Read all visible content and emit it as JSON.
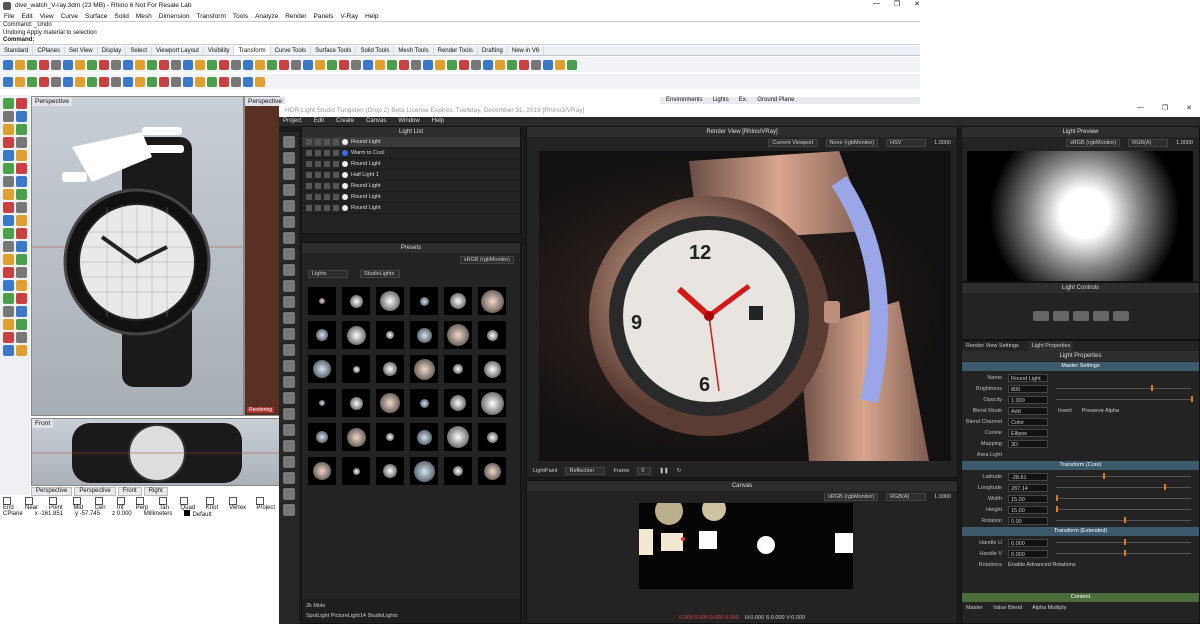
{
  "rhino": {
    "title": "dive_watch_V-ray.3dm (23 MB) - Rhino 6 Not For Resale Lab",
    "window_controls": [
      "—",
      "❐",
      "✕"
    ],
    "menu": [
      "File",
      "Edit",
      "View",
      "Curve",
      "Surface",
      "Solid",
      "Mesh",
      "Dimension",
      "Transform",
      "Tools",
      "Analyze",
      "Render",
      "Panels",
      "V-Ray",
      "Help"
    ],
    "command_lines": [
      "Command: _Undo",
      "Undoing Apply material to selection"
    ],
    "command_prompt": "Command:",
    "toolbar_tabs": [
      "Standard",
      "CPlanes",
      "Set View",
      "Display",
      "Select",
      "Viewport Layout",
      "Visibility",
      "Transform",
      "Curve Tools",
      "Surface Tools",
      "Solid Tools",
      "Mesh Tools",
      "Render Tools",
      "Drafting",
      "New in V6"
    ],
    "selected_tab": "Transform",
    "viewports": {
      "perspective": "Perspective",
      "perspective2": "Perspective",
      "front": "Front",
      "rendering": "Rendering"
    },
    "viewport_tabs": [
      "Perspective",
      "Perspective",
      "Front",
      "Right"
    ],
    "osnaps": [
      "End",
      "Near",
      "Point",
      "Mid",
      "Cen",
      "Int",
      "Perp",
      "Tan",
      "Quad",
      "Knot",
      "Vertex",
      "Project"
    ],
    "status": {
      "cplane": "CPlane",
      "x": "x -161.851",
      "y": "y -57.745",
      "z": "z 0.000",
      "units": "Millimeters",
      "layer": "Default"
    },
    "side_panel_tabs": [
      "Environments",
      "Lights",
      "Ex.",
      "Ground Plane"
    ]
  },
  "hls": {
    "title": "HDR Light Studio Tungsten (Drop 2) Beta License Expires: Tuesday, December 31, 2019 [Rhino3/VRay]",
    "window_controls": [
      "—",
      "❐",
      "✕"
    ],
    "menu": [
      "Project",
      "Edit",
      "Create",
      "Canvas",
      "Window",
      "Help"
    ],
    "light_list": {
      "title": "Light List",
      "items": [
        "Round Light",
        "Warm to Cool",
        "Round Light",
        "Half Light 1",
        "Round Light",
        "Round Light",
        "Round Light"
      ]
    },
    "presets": {
      "title": "Presets",
      "color_space": "sRGB (rgbMonitor)",
      "category": "Lights",
      "library": "StudioLights",
      "footer_name": "2k Mole",
      "footer_path": "SpotLight PictureLight14 StudioLights"
    },
    "render_view": {
      "title": "Render View [Rhino/VRay]",
      "viewport": "Current Viewport",
      "display": "None (rgbMonitor)",
      "mode": "HSV",
      "exposure": "1.0000",
      "lightpaint": "LightPaint",
      "lightpaint_mode": "Reflection",
      "frame_label": "Frame",
      "frame": "0"
    },
    "canvas": {
      "title": "Canvas",
      "color_space": "sRGB (rgbMonitor)",
      "channel": "RGB(A)",
      "exposure": "1.0000",
      "readout_rgb": "0.000  0.000  0.000  0.000",
      "readout_hsv": "H:0.000 S:0.000 V:0.000"
    },
    "light_preview": {
      "title": "Light Preview",
      "color_space": "sRGB (rgbMonitor)",
      "channel": "RGB(A)",
      "exposure": "1.0000"
    },
    "light_controls": {
      "title": "Light Controls"
    },
    "props": {
      "tabs": [
        "Render View Settings",
        "Light Properties"
      ],
      "title": "Light Properties",
      "master": "Master Settings",
      "name_label": "Name",
      "name": "Round Light",
      "brightness_label": "Brightness",
      "brightness": "800",
      "opacity_label": "Opacity",
      "opacity": "1.000",
      "blend_mode_label": "Blend Mode",
      "blend_mode": "Add",
      "invert": "Invert",
      "preserve_alpha": "Preserve Alpha",
      "blend_channel_label": "Blend Channel",
      "blend_channel": "Color",
      "cookie_label": "Cookie",
      "cookie": "Ellipse",
      "mapping_label": "Mapping",
      "mapping": "3D",
      "area_light": "Area Light",
      "transform_core": "Transform (Core)",
      "latitude_label": "Latitude",
      "latitude": "-28.61",
      "longitude_label": "Longitude",
      "longitude": "287.14",
      "width_label": "Width",
      "width": "15.00",
      "height_label": "Height",
      "height": "15.00",
      "rotation_label": "Rotation",
      "rotation": "0.00",
      "transform_ext": "Transform (Extended)",
      "handle_u_label": "Handle U",
      "handle_u": "0.000",
      "handle_v_label": "Handle V",
      "handle_v": "0.000",
      "rotations_label": "Rotations",
      "adv_rotations": "Enable Advanced Rotations",
      "content": "Content",
      "bottom_tabs": [
        "Master",
        "Value Blend",
        "Alpha Multiply"
      ]
    }
  }
}
